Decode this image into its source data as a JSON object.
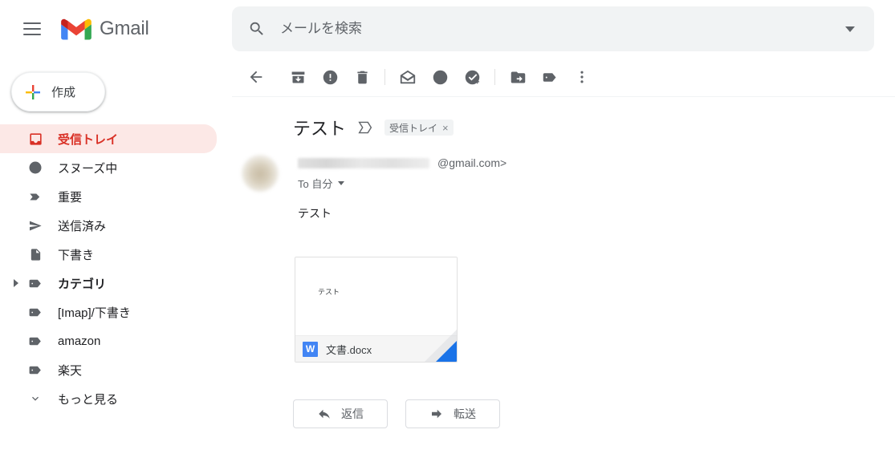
{
  "app": {
    "brand": "Gmail",
    "lang": "ja",
    "accent_red": "#d93025",
    "accent_blue": "#1a73e8",
    "active_pill_bg": "#fce8e6"
  },
  "header": {
    "menu_icon": "hamburger-menu-icon",
    "logo_icon": "gmail-logo-icon",
    "brand_label": "Gmail"
  },
  "search": {
    "icon": "search-icon",
    "placeholder": "メールを検索",
    "value": "",
    "options_icon": "chevron-down-icon"
  },
  "sidebar": {
    "compose": {
      "label": "作成",
      "icon": "plus-icon"
    },
    "items": [
      {
        "label": "受信トレイ",
        "icon": "inbox-icon",
        "active": true,
        "bold": true,
        "twisty": ""
      },
      {
        "label": "スヌーズ中",
        "icon": "clock-icon",
        "active": false,
        "bold": false,
        "twisty": ""
      },
      {
        "label": "重要",
        "icon": "important-icon",
        "active": false,
        "bold": false,
        "twisty": ""
      },
      {
        "label": "送信済み",
        "icon": "sent-icon",
        "active": false,
        "bold": false,
        "twisty": ""
      },
      {
        "label": "下書き",
        "icon": "draft-icon",
        "active": false,
        "bold": false,
        "twisty": ""
      },
      {
        "label": "カテゴリ",
        "icon": "label-icon",
        "active": false,
        "bold": true,
        "twisty": "▸"
      },
      {
        "label": "[Imap]/下書き",
        "icon": "label-icon",
        "active": false,
        "bold": false,
        "twisty": ""
      },
      {
        "label": "amazon",
        "icon": "label-icon",
        "active": false,
        "bold": false,
        "twisty": ""
      },
      {
        "label": "楽天",
        "icon": "label-icon",
        "active": false,
        "bold": false,
        "twisty": ""
      },
      {
        "label": "もっと見る",
        "icon": "chevron-down-icon",
        "active": false,
        "bold": false,
        "twisty": ""
      }
    ]
  },
  "toolbar": {
    "buttons": [
      {
        "name": "back-button",
        "icon": "arrow-left-icon"
      },
      {
        "name": "archive-button",
        "icon": "archive-icon"
      },
      {
        "name": "report-spam-button",
        "icon": "report-spam-icon"
      },
      {
        "name": "delete-button",
        "icon": "trash-icon"
      },
      {
        "name": "mark-unread-button",
        "icon": "mark-unread-icon"
      },
      {
        "name": "snooze-button",
        "icon": "clock-icon"
      },
      {
        "name": "add-to-tasks-button",
        "icon": "add-task-icon"
      },
      {
        "name": "move-to-button",
        "icon": "move-to-folder-icon"
      },
      {
        "name": "labels-button",
        "icon": "label-icon"
      },
      {
        "name": "more-options-button",
        "icon": "more-vertical-icon"
      }
    ]
  },
  "message": {
    "subject": "テスト",
    "inbox_arrow_icon": "inbox-arrow-icon",
    "label_chip": {
      "text": "受信トレイ",
      "remove": "×"
    },
    "avatar": "sender-avatar",
    "sender_name_redacted": true,
    "sender_domain": "@gmail.com>",
    "to_line": "To 自分",
    "to_caret_icon": "chevron-down-icon",
    "body": "テスト"
  },
  "attachment": {
    "preview_text": "テスト",
    "file_icon": "word-doc-icon",
    "file_icon_letter": "W",
    "filename": "文書.docx",
    "download_corner": "download-corner-icon"
  },
  "actions": {
    "reply": {
      "label": "返信",
      "icon": "reply-arrow-icon"
    },
    "forward": {
      "label": "転送",
      "icon": "forward-arrow-icon"
    }
  }
}
